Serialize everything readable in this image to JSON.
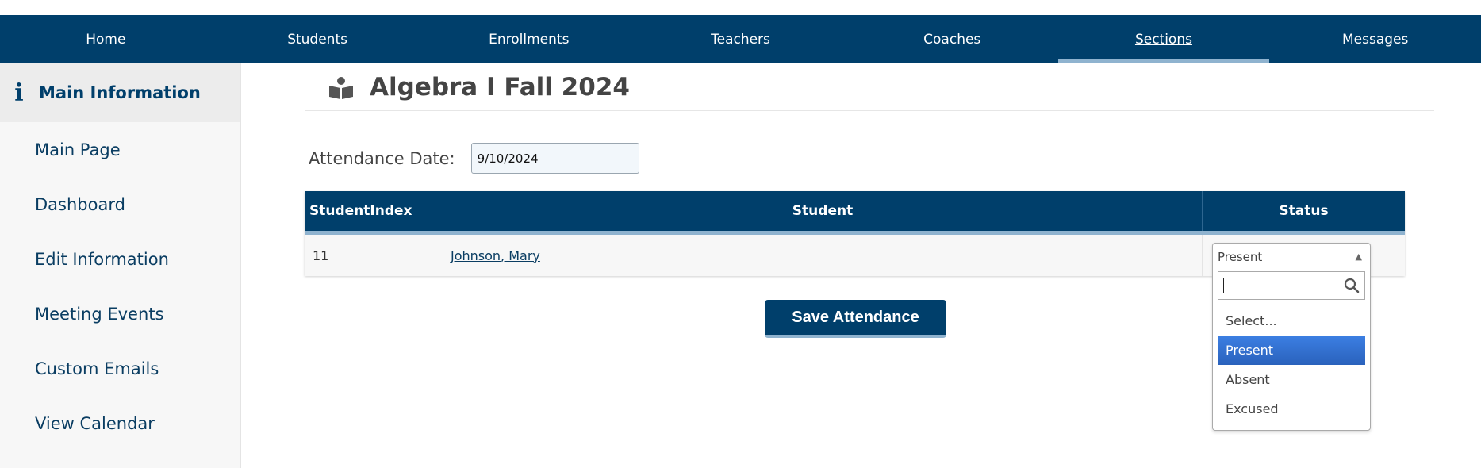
{
  "nav": {
    "items": [
      {
        "label": "Home"
      },
      {
        "label": "Students"
      },
      {
        "label": "Enrollments"
      },
      {
        "label": "Teachers"
      },
      {
        "label": "Coaches"
      },
      {
        "label": "Sections"
      },
      {
        "label": "Messages"
      }
    ],
    "active_index": 5
  },
  "sidebar": {
    "header": "Main Information",
    "header_icon": "info-icon",
    "items": [
      {
        "label": "Main Page"
      },
      {
        "label": "Dashboard"
      },
      {
        "label": "Edit Information"
      },
      {
        "label": "Meeting Events"
      },
      {
        "label": "Custom Emails"
      },
      {
        "label": "View Calendar"
      }
    ]
  },
  "page": {
    "icon": "book-reader-icon",
    "title": "Algebra I Fall 2024"
  },
  "attendance": {
    "label": "Attendance Date:",
    "date_value": "9/10/2024"
  },
  "grid": {
    "columns": [
      "StudentIndex",
      "Student",
      "Status"
    ],
    "rows": [
      {
        "index": "11",
        "student": "Johnson, Mary",
        "status": "Present"
      }
    ]
  },
  "save_button": "Save Attendance",
  "status_dropdown": {
    "selected": "Present",
    "search_value": "",
    "options": [
      "Select...",
      "Present",
      "Absent",
      "Excused"
    ],
    "highlighted_index": 1
  },
  "colors": {
    "nav_bg": "#003f6b",
    "accent": "#8fb3cf",
    "highlight": "#3875d7"
  }
}
